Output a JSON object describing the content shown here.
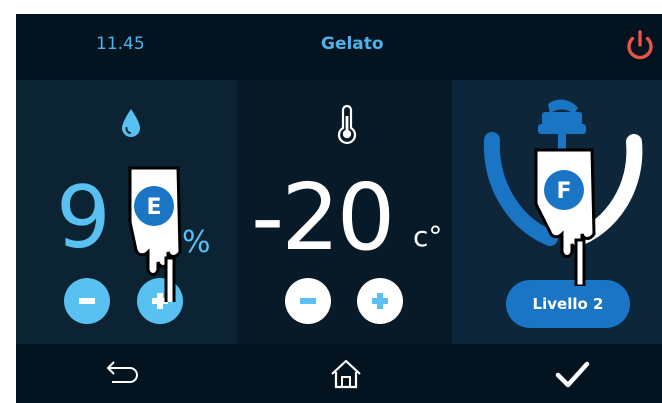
{
  "header": {
    "time": "11.45",
    "title": "Gelato",
    "power_icon": "power-icon"
  },
  "humidity": {
    "icon": "water-drop-icon",
    "value_visible": "9",
    "unit": "%",
    "minus_label": "-",
    "plus_label": "+"
  },
  "temperature": {
    "icon": "thermometer-icon",
    "value": "-20",
    "unit": "c°",
    "minus_label": "-",
    "plus_label": "+"
  },
  "stirrer": {
    "icon": "stirrer-paddle-icon",
    "level_label": "Livello 2"
  },
  "footer": {
    "back_icon": "back-arrow-icon",
    "home_icon": "home-icon",
    "confirm_icon": "checkmark-icon"
  },
  "callouts": {
    "e_label": "E",
    "f_label": "F"
  },
  "colors": {
    "accent_blue": "#59c0f2",
    "button_blue": "#1a75c5",
    "power_red": "#e8534a",
    "background": "#0b1c2c"
  }
}
